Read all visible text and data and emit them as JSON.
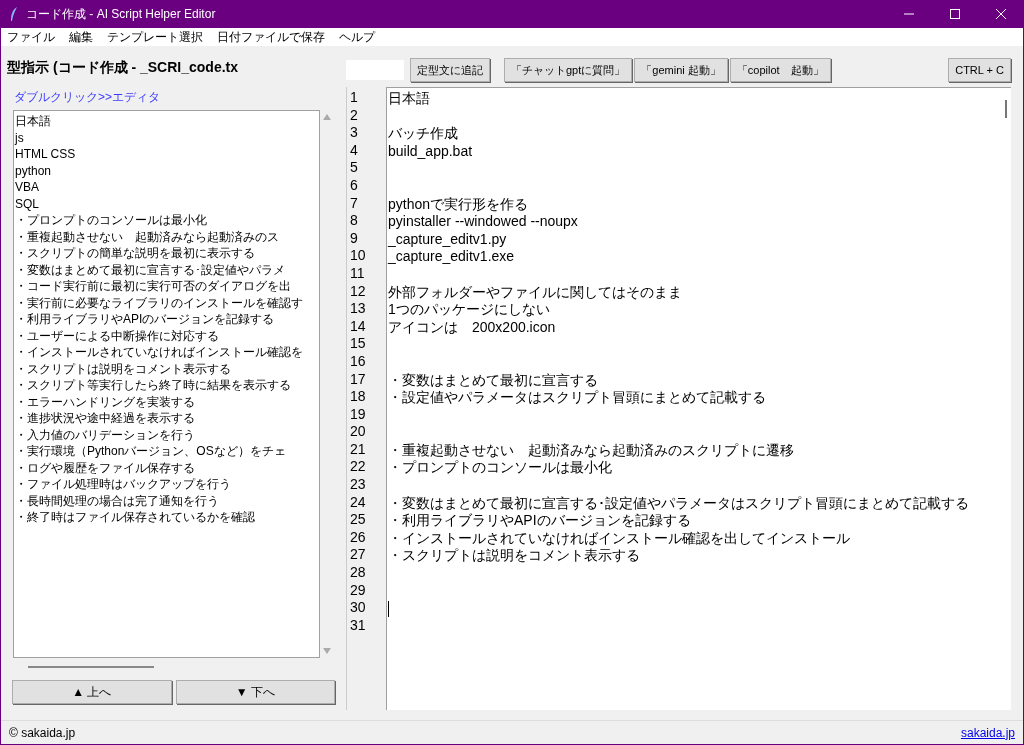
{
  "window": {
    "title": "コード作成 - AI Script Helper Editor"
  },
  "menu": [
    "ファイル",
    "編集",
    "テンプレート選択",
    "日付ファイルで保存",
    "ヘルプ"
  ],
  "left_panel": {
    "heading": "型指示 (コード作成 - _SCRI_code.tx",
    "hint_link": "ダブルクリック>>エディタ",
    "items": [
      "日本語",
      "js",
      "HTML CSS",
      "python",
      "VBA",
      "SQL",
      "・プロンプトのコンソールは最小化",
      "・重複起動させない　起動済みなら起動済みのス",
      "・スクリプトの簡単な説明を最初に表示する",
      "・変数はまとめて最初に宣言する･設定値やパラメ",
      "・コード実行前に最初に実行可否のダイアログを出",
      "・実行前に必要なライブラリのインストールを確認す",
      "・利用ライブラリやAPIのバージョンを記録する",
      "・ユーザーによる中断操作に対応する",
      "・インストールされていなければインストール確認を",
      "・スクリプトは説明をコメント表示する",
      "・スクリプト等実行したら終了時に結果を表示する",
      "・エラーハンドリングを実装する",
      "・進捗状況や途中経過を表示する",
      "・入力値のバリデーションを行う",
      "・実行環境（Pythonバージョン、OSなど）をチェ",
      "・ログや履歴をファイル保存する",
      "・ファイル処理時はバックアップを行う",
      "・長時間処理の場合は完了通知を行う",
      "・終了時はファイル保存されているかを確認"
    ],
    "buttons": [
      "▲ 上へ",
      "▼ 下へ"
    ]
  },
  "toolbar": {
    "append_button": "定型文に追記",
    "buttons": [
      "「チャットgptに質問」",
      "「gemini 起動」",
      "「copilot　起動」"
    ],
    "copy_button": "CTRL + C"
  },
  "editor": {
    "lines": [
      {
        "number": "1",
        "text": "日本語",
        "caret": false
      },
      {
        "number": "2",
        "caret": false
      },
      {
        "number": "3",
        "text": "バッチ作成",
        "caret": false
      },
      {
        "number": "4",
        "text": "build_app.bat",
        "caret": false
      },
      {
        "number": "5",
        "caret": false
      },
      {
        "number": "6",
        "caret": false
      },
      {
        "number": "7",
        "text": "pythonで実行形を作る",
        "caret": false
      },
      {
        "number": "8",
        "text": "pyinstaller --windowed --noupx",
        "caret": false
      },
      {
        "number": "9",
        "text": "_capture_editv1.py",
        "caret": false
      },
      {
        "number": "10",
        "text": "_capture_editv1.exe",
        "caret": false
      },
      {
        "number": "11",
        "caret": false
      },
      {
        "number": "12",
        "text": "外部フォルダーやファイルに関してはそのまま",
        "caret": false
      },
      {
        "number": "13",
        "text": "1つのパッケージにしない",
        "caret": false
      },
      {
        "number": "14",
        "text": "アイコンは　200x200.icon",
        "caret": false
      },
      {
        "number": "15",
        "caret": false
      },
      {
        "number": "16",
        "caret": false
      },
      {
        "number": "17",
        "text": "・変数はまとめて最初に宣言する",
        "caret": false
      },
      {
        "number": "18",
        "text": "・設定値やパラメータはスクリプト冒頭にまとめて記載する",
        "caret": false
      },
      {
        "number": "19",
        "caret": false
      },
      {
        "number": "20",
        "caret": false
      },
      {
        "number": "21",
        "text": "・重複起動させない　起動済みなら起動済みのスクリプトに遷移",
        "caret": false
      },
      {
        "number": "22",
        "text": "・プロンプトのコンソールは最小化",
        "caret": false
      },
      {
        "number": "23",
        "caret": false
      },
      {
        "number": "24",
        "text": "・変数はまとめて最初に宣言する･設定値やパラメータはスクリプト冒頭にまとめて記載する",
        "caret": false
      },
      {
        "number": "25",
        "text": "・利用ライブラリやAPIのバージョンを記録する",
        "caret": false
      },
      {
        "number": "26",
        "text": "・インストールされていなければインストール確認を出してインストール",
        "caret": false
      },
      {
        "number": "27",
        "text": "・スクリプトは説明をコメント表示する",
        "caret": false
      },
      {
        "number": "28",
        "caret": false
      },
      {
        "number": "29",
        "caret": false
      },
      {
        "number": "30",
        "caret": true
      },
      {
        "number": "31",
        "caret": false
      }
    ]
  },
  "status_bar": {
    "copyright": "© sakaida.jp",
    "link": "sakaida.jp"
  }
}
